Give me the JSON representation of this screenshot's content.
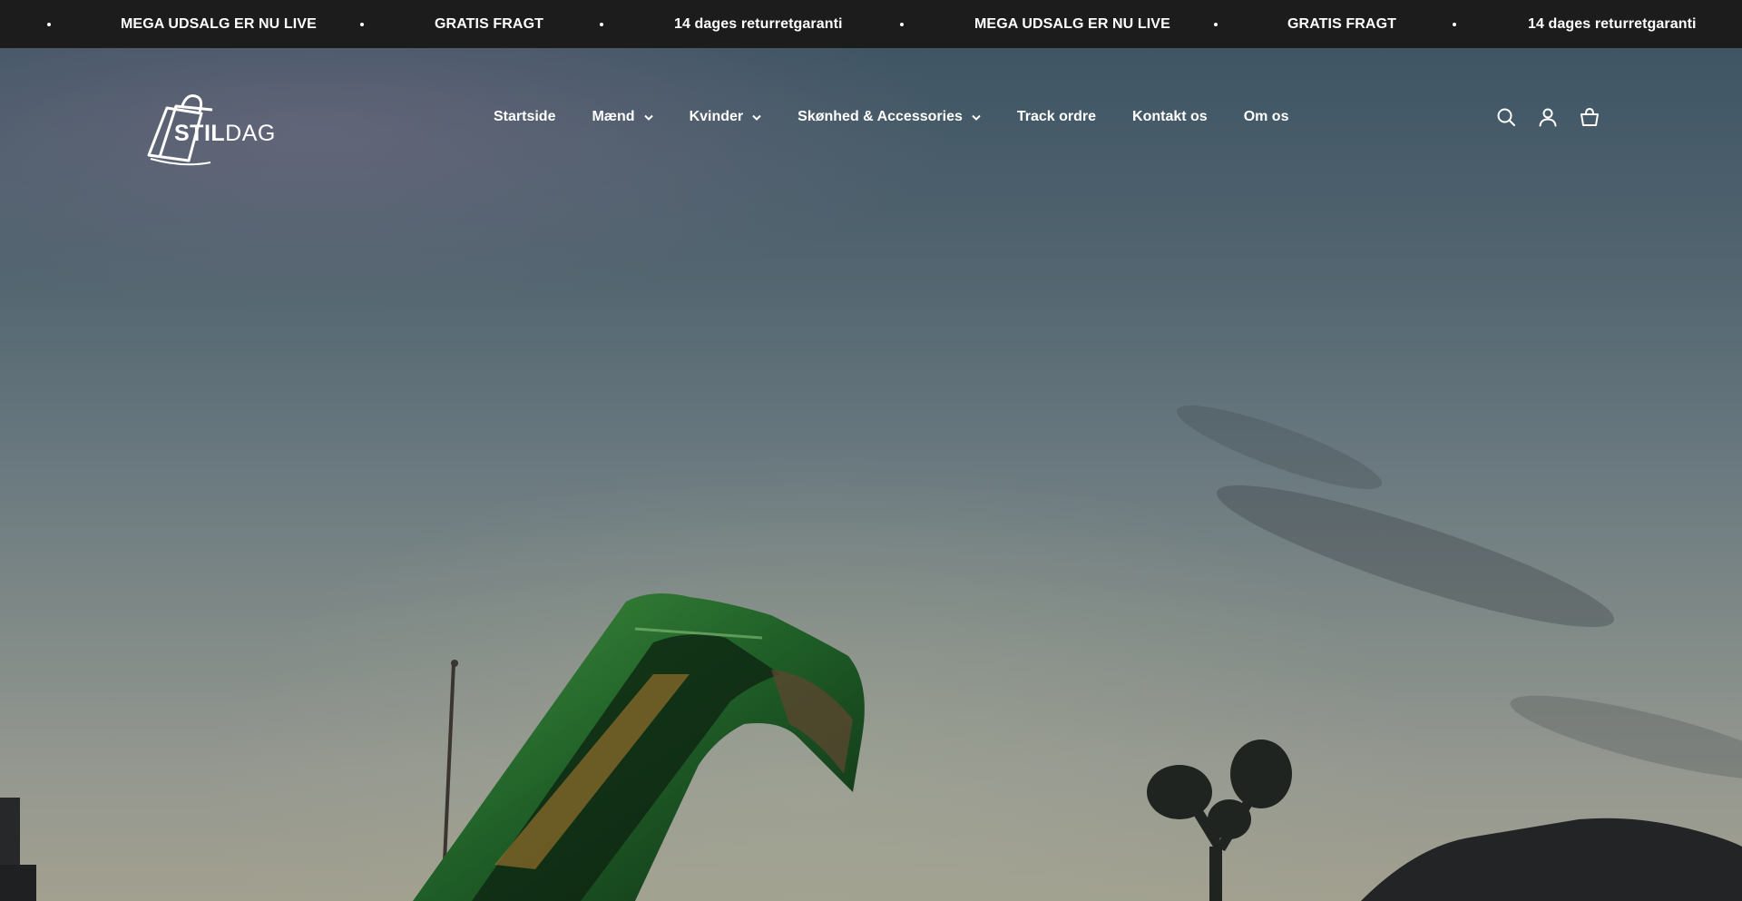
{
  "announcement_bar": {
    "items": [
      "MEGA UDSALG ER NU LIVE",
      "GRATIS FRAGT",
      "14 dages returretgaranti",
      "MEGA UDSALG ER NU LIVE",
      "GRATIS FRAGT",
      "14 dages returretgaranti"
    ]
  },
  "header": {
    "logo": {
      "bold_part": "STIL",
      "light_part": "DAG"
    },
    "nav": [
      {
        "label": "Startside",
        "has_dropdown": false
      },
      {
        "label": "Mænd",
        "has_dropdown": true
      },
      {
        "label": "Kvinder",
        "has_dropdown": true
      },
      {
        "label": "Skønhed & Accessories",
        "has_dropdown": true
      },
      {
        "label": "Track ordre",
        "has_dropdown": false
      },
      {
        "label": "Kontakt os",
        "has_dropdown": false
      },
      {
        "label": "Om os",
        "has_dropdown": false
      }
    ],
    "icons": [
      "search-icon",
      "account-icon",
      "cart-icon"
    ]
  },
  "colors": {
    "announcement_bg": "#1c1c1c",
    "text": "#ffffff"
  }
}
